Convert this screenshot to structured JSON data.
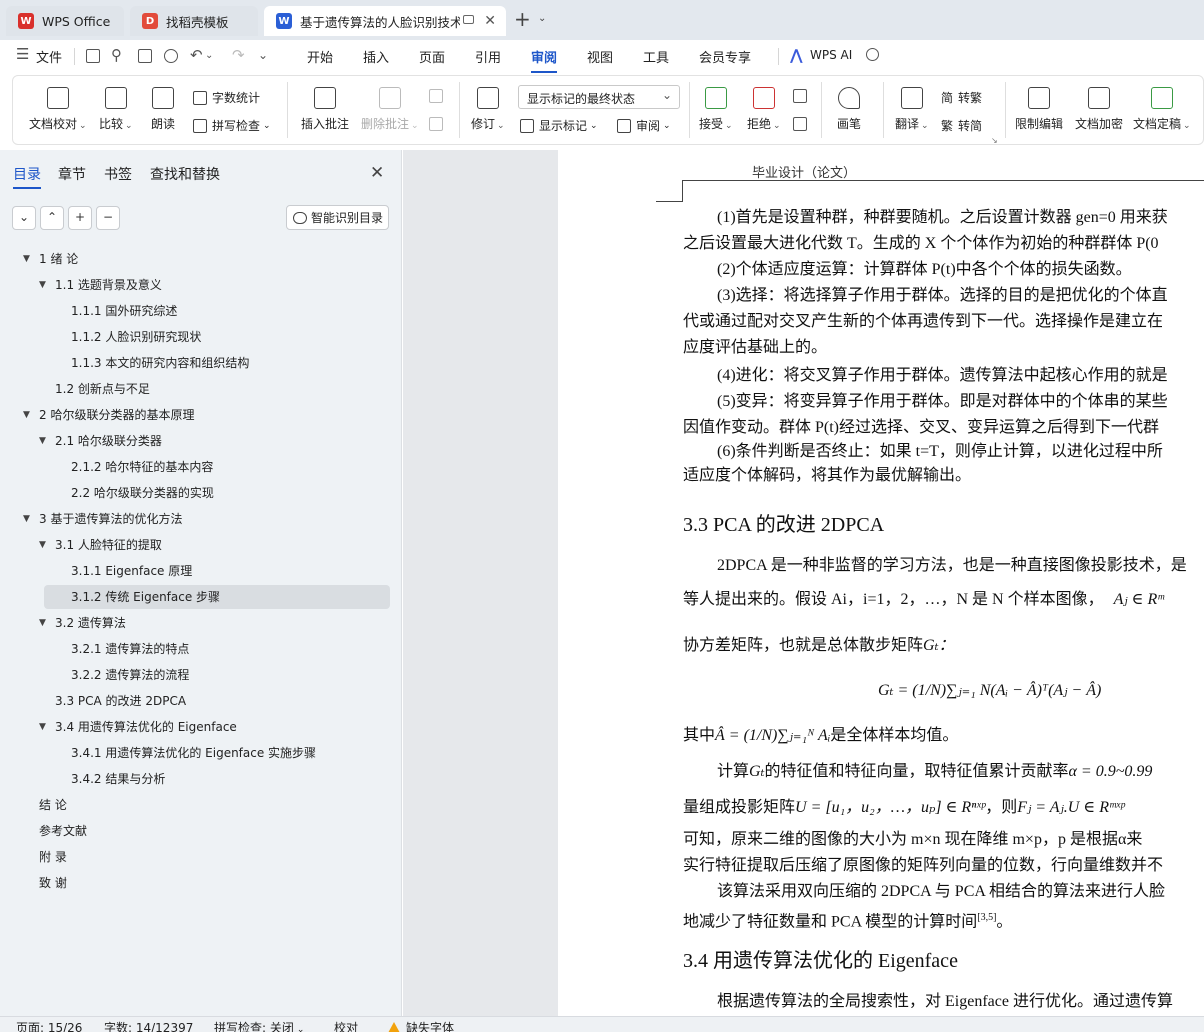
{
  "tabs": [
    {
      "label": "WPS Office",
      "color": "#d9302c",
      "glyph": "W"
    },
    {
      "label": "找稻壳模板",
      "color": "#e24b3b",
      "glyph": "D"
    },
    {
      "label": "基于遗传算法的人脸识别技术",
      "color": "#2b5fd6",
      "glyph": "W"
    }
  ],
  "menu": {
    "file": "文件",
    "items": [
      "开始",
      "插入",
      "页面",
      "引用",
      "审阅",
      "视图",
      "工具",
      "会员专享"
    ],
    "active": "审阅",
    "wps_ai": "WPS AI"
  },
  "ribbon": {
    "doc_check": "文档校对",
    "compare": "比较",
    "read_aloud": "朗读",
    "word_count": "字数统计",
    "spell_check": "拼写检查",
    "insert_comment": "插入批注",
    "delete_comment": "删除批注",
    "revise": "修订",
    "show_final_state": "显示标记的最终状态",
    "show_marks": "显示标记",
    "review_pane": "审阅",
    "accept": "接受",
    "reject": "拒绝",
    "ink": "画笔",
    "translate": "翻译",
    "to_traditional": "转繁",
    "to_simplified": "转简",
    "trad_glyph": "简",
    "simp_glyph": "繁",
    "restrict_edit": "限制编辑",
    "encrypt": "文档加密",
    "finalize": "文档定稿"
  },
  "nav": {
    "tabs": [
      "目录",
      "章节",
      "书签",
      "查找和替换"
    ],
    "active_tab": "目录",
    "smart_toc": "智能识别目录",
    "controls": [
      "⌄",
      "⌃",
      "+",
      "−"
    ],
    "toc": [
      {
        "label": "1  绪  论",
        "level": 1,
        "expanded": true
      },
      {
        "label": "1.1  选题背景及意义",
        "level": 2,
        "expanded": true
      },
      {
        "label": "1.1.1  国外研究综述",
        "level": 3
      },
      {
        "label": "1.1.2  人脸识别研究现状",
        "level": 3
      },
      {
        "label": "1.1.3 本文的研究内容和组织结构",
        "level": 3
      },
      {
        "label": "1.2  创新点与不足",
        "level": 2
      },
      {
        "label": "2 哈尔级联分类器的基本原理",
        "level": 1,
        "expanded": true
      },
      {
        "label": "2.1 哈尔级联分类器",
        "level": 2,
        "expanded": true
      },
      {
        "label": "2.1.2 哈尔特征的基本内容",
        "level": 3
      },
      {
        "label": "2.2  哈尔级联分类器的实现",
        "level": 3
      },
      {
        "label": "3 基于遗传算法的优化方法",
        "level": 1,
        "expanded": true
      },
      {
        "label": "3.1 人脸特征的提取",
        "level": 2,
        "expanded": true
      },
      {
        "label": "3.1.1 Eigenface 原理",
        "level": 3
      },
      {
        "label": "3.1.2 传统 Eigenface 步骤",
        "level": 3,
        "selected": true
      },
      {
        "label": "3.2  遗传算法",
        "level": 2,
        "expanded": true
      },
      {
        "label": "3.2.1 遗传算法的特点",
        "level": 3
      },
      {
        "label": "3.2.2  遗传算法的流程",
        "level": 3
      },
      {
        "label": "3.3 PCA 的改进 2DPCA",
        "level": 2
      },
      {
        "label": "3.4  用遗传算法优化的 Eigenface",
        "level": 2,
        "expanded": true
      },
      {
        "label": "3.4.1 用遗传算法优化的 Eigenface 实施步骤",
        "level": 3
      },
      {
        "label": "3.4.2  结果与分析",
        "level": 3
      },
      {
        "label": "结  论",
        "level": 1
      },
      {
        "label": "参考文献",
        "level": 1
      },
      {
        "label": "附  录",
        "level": 1
      },
      {
        "label": "致  谢",
        "level": 1
      }
    ]
  },
  "doc": {
    "running_head": "毕业设计（论文）",
    "lines": [
      {
        "text": "(1)首先是设置种群，种群要随机。之后设置计数器 gen=0 用来获",
        "indent": true
      },
      {
        "text": "之后设置最大进化代数 T。生成的 X 个个体作为初始的种群群体 P(0",
        "indent": false
      },
      {
        "text": "(2)个体适应度运算：计算群体 P(t)中各个个体的损失函数。",
        "indent": true
      },
      {
        "text": "(3)选择：将选择算子作用于群体。选择的目的是把优化的个体直",
        "indent": true
      },
      {
        "text": "代或通过配对交叉产生新的个体再遗传到下一代。选择操作是建立在",
        "indent": false
      },
      {
        "text": "应度评估基础上的。",
        "indent": false
      },
      {
        "text": "(4)进化：将交叉算子作用于群体。遗传算法中起核心作用的就是",
        "indent": true
      },
      {
        "text": "(5)变异：将变异算子作用于群体。即是对群体中的个体串的某些",
        "indent": true
      },
      {
        "text": "因值作变动。群体 P(t)经过选择、交叉、变异运算之后得到下一代群",
        "indent": false
      },
      {
        "text": "(6)条件判断是否终止：如果 t=T，则停止计算，以进化过程中所",
        "indent": true
      },
      {
        "text": "适应度个体解码，将其作为最优解输出。",
        "indent": false
      }
    ],
    "heading_33": "3.3 PCA 的改进 2DPCA",
    "p33_l1": "2DPCA 是一种非监督的学习方法，也是一种直接图像投影技术，是",
    "p33_l2": "等人提出来的。假设 Ai，i=1，2，…，N 是 N 个样本图像，",
    "p33_l2_math": "Aⱼ ∈ Rᵐ",
    "p33_l3": "协方差矩阵，也就是总体散步矩阵",
    "p33_l3_math": "Gₜ：",
    "formula": "Gₜ = (1/N)∑ⱼ₌₁ N(Aᵢ − Â)ᵀ(Aⱼ − Â)",
    "mean_line_prefix": "其中",
    "mean_math": "Â = (1/N)∑ⱼ₌₁ᴺ Aᵢ",
    "mean_line_suffix": "是全体样本均值。",
    "eig_l1a": "计算",
    "eig_l1_math1": "Gₜ",
    "eig_l1b": "的特征值和特征向量，取特征值累计贡献率",
    "eig_l1_math2": "α = 0.9~0.99",
    "eig_l2a": "量组成投影矩阵",
    "eig_l2_math1": "U = [u₁，u₂，…，uₚ] ∈ Rⁿˣᵖ",
    "eig_l2b": "，则",
    "eig_l2_math2": "Fⱼ = Aⱼ.U ∈ Rᵐˣᵖ",
    "eig_l3": "可知，原来二维的图像的大小为 m×n 现在降维 m×p，p 是根据α来",
    "eig_l4": "实行特征提取后压缩了原图像的矩阵列向量的位数，行向量维数并不",
    "eig_l5": "该算法采用双向压缩的 2DPCA 与 PCA 相结合的算法来进行人脸",
    "eig_l6": "地减少了特征数量和 PCA 模型的计算时间",
    "eig_l6_cite": "[3,5]",
    "eig_l6_end": "。",
    "heading_34": "3.4  用遗传算法优化的 Eigenface",
    "p34_l1": "根据遗传算法的全局搜索性，对 Eigenface 进行优化。通过遗传算"
  },
  "status": {
    "page": "页面: 15/26",
    "words": "字数: 14/12397",
    "spell": "拼写检查: 关闭",
    "proof": "校对",
    "missing_font": "缺失字体"
  },
  "colors": {
    "accent": "#1d56c9",
    "warning": "#f2a20c"
  }
}
